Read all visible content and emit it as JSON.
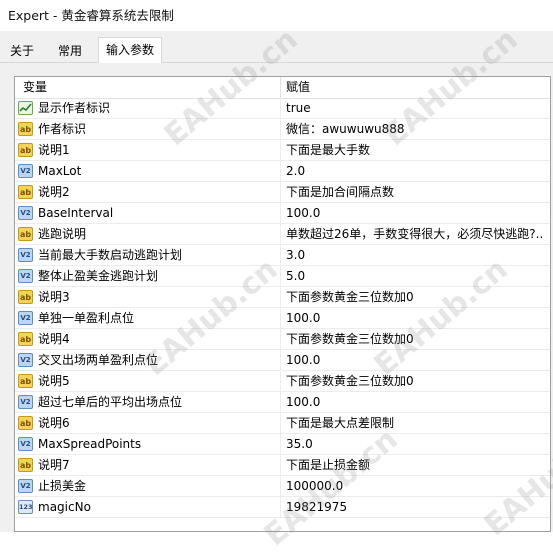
{
  "window": {
    "title": "Expert - 黄金睿算系统去限制"
  },
  "tabs": [
    {
      "label": "关于",
      "active": false
    },
    {
      "label": "常用",
      "active": false
    },
    {
      "label": "输入参数",
      "active": true
    }
  ],
  "table": {
    "headers": {
      "variable": "变量",
      "value": "赋值"
    },
    "rows": [
      {
        "icon": "bool-icon",
        "name": "显示作者标识",
        "value": "true"
      },
      {
        "icon": "ab-icon",
        "name": "作者标识",
        "value": " 微信：awuwuwu888"
      },
      {
        "icon": "ab-icon",
        "name": "说明1",
        "value": "下面是最大手数"
      },
      {
        "icon": "vn-icon",
        "name": "MaxLot",
        "value": "2.0"
      },
      {
        "icon": "ab-icon",
        "name": "说明2",
        "value": "下面是加合间隔点数"
      },
      {
        "icon": "vn-icon",
        "name": "BaseInterval",
        "value": "100.0"
      },
      {
        "icon": "ab-icon",
        "name": "逃跑说明",
        "value": "单数超过26单，手数变得很大，必须尽快逃跑?.."
      },
      {
        "icon": "vn-icon",
        "name": "当前最大手数启动逃跑计划",
        "value": "3.0"
      },
      {
        "icon": "vn-icon",
        "name": "整体止盈美金逃跑计划",
        "value": "5.0"
      },
      {
        "icon": "ab-icon",
        "name": "说明3",
        "value": "下面参数黄金三位数加0"
      },
      {
        "icon": "vn-icon",
        "name": "单独一单盈利点位",
        "value": "100.0"
      },
      {
        "icon": "ab-icon",
        "name": "说明4",
        "value": "下面参数黄金三位数加0"
      },
      {
        "icon": "vn-icon",
        "name": "交叉出场两单盈利点位",
        "value": "100.0"
      },
      {
        "icon": "ab-icon",
        "name": "说明5",
        "value": "下面参数黄金三位数加0"
      },
      {
        "icon": "vn-icon",
        "name": "超过七单后的平均出场点位",
        "value": "100.0"
      },
      {
        "icon": "ab-icon",
        "name": "说明6",
        "value": "下面是最大点差限制"
      },
      {
        "icon": "vn-icon",
        "name": "MaxSpreadPoints",
        "value": "35.0"
      },
      {
        "icon": "ab-icon",
        "name": "说明7",
        "value": "下面是止损金额"
      },
      {
        "icon": "vn-icon",
        "name": "止损美金",
        "value": "100000.0"
      },
      {
        "icon": "num-icon",
        "name": "magicNo",
        "value": "19821975"
      }
    ]
  },
  "icon_glyphs": {
    "ab": "ab",
    "vn": "V2",
    "num": "123"
  },
  "watermark": "EAHub.cn"
}
